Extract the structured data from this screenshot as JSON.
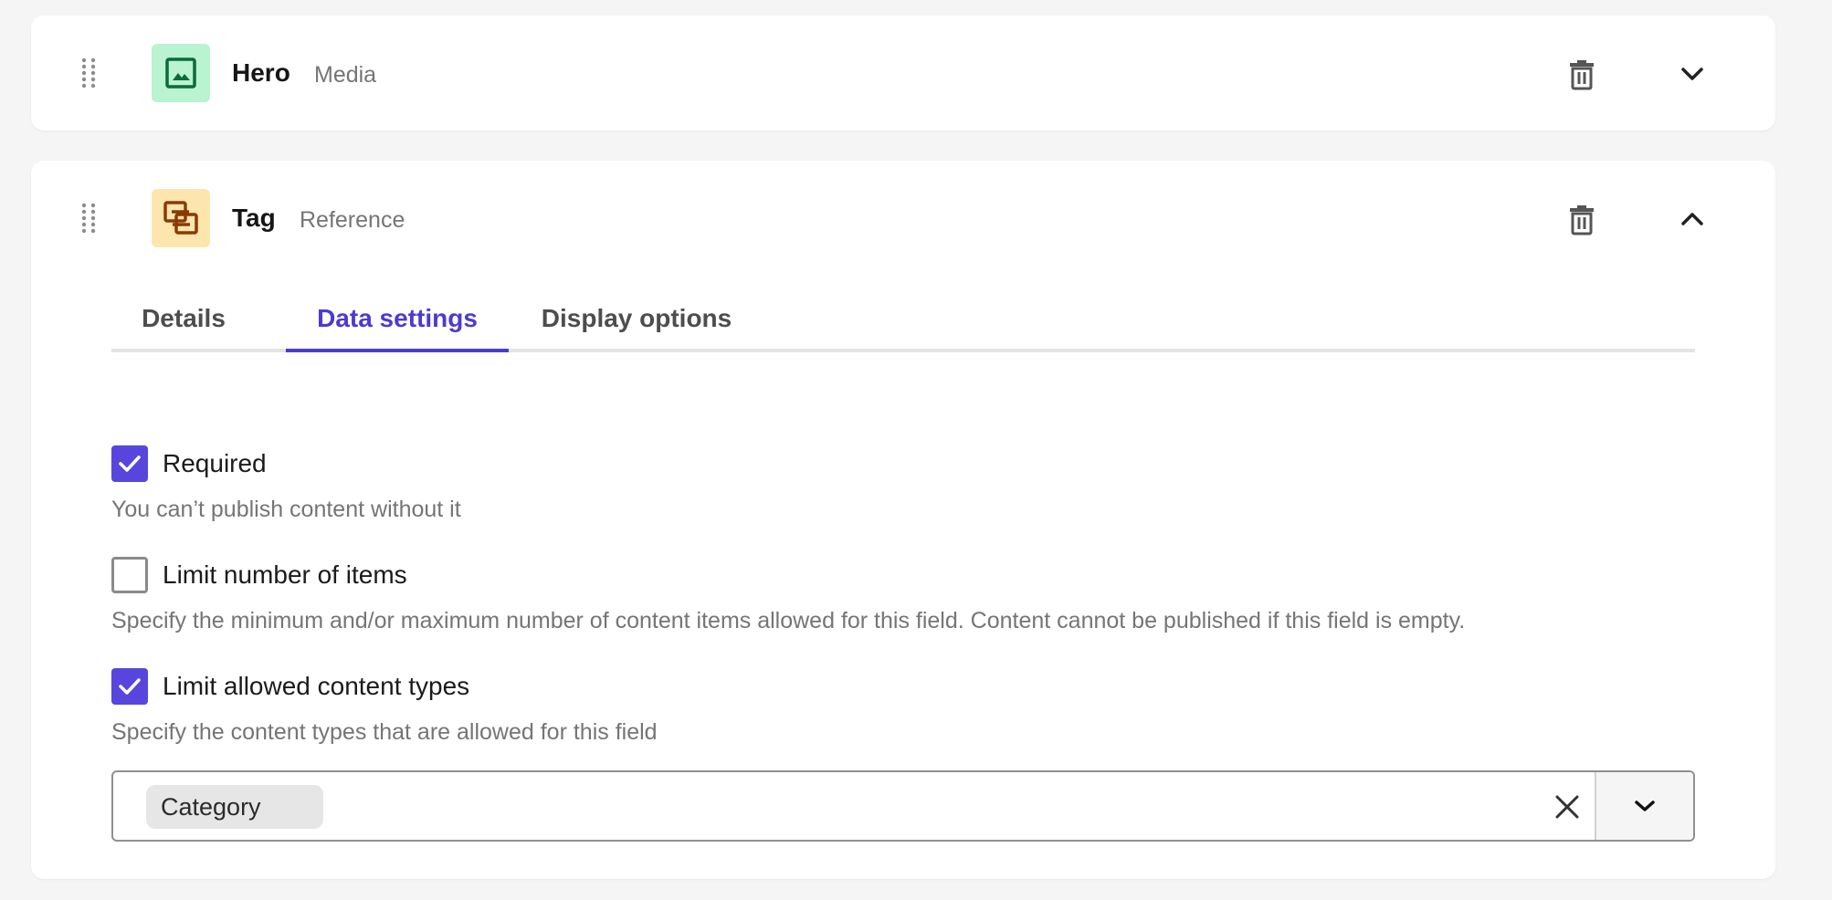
{
  "fields": [
    {
      "name": "Hero",
      "type_label": "Media",
      "icon": "image-icon",
      "icon_bg": "#b9f3cf",
      "icon_color": "#0b6b3a",
      "expanded": false
    },
    {
      "name": "Tag",
      "type_label": "Reference",
      "icon": "reference-link-icon",
      "icon_bg": "#fde6ad",
      "icon_color": "#8a3a06",
      "expanded": true,
      "tabs": [
        {
          "label": "Details",
          "active": false
        },
        {
          "label": "Data settings",
          "active": true
        },
        {
          "label": "Display options",
          "active": false
        }
      ],
      "settings": [
        {
          "label": "Required",
          "checked": true,
          "help": "You can’t publish content without it"
        },
        {
          "label": "Limit number of items",
          "checked": false,
          "help": "Specify the minimum and/or maximum number of content items allowed for this field. Content cannot be published if this field is empty."
        },
        {
          "label": "Limit allowed content types",
          "checked": true,
          "help": "Specify the content types that are allowed for this field"
        }
      ],
      "allowed_content_types": [
        "Category"
      ]
    }
  ],
  "colors": {
    "accent": "#4a3bd1",
    "checkbox_checked": "#5746dd",
    "muted_text": "#757575"
  }
}
